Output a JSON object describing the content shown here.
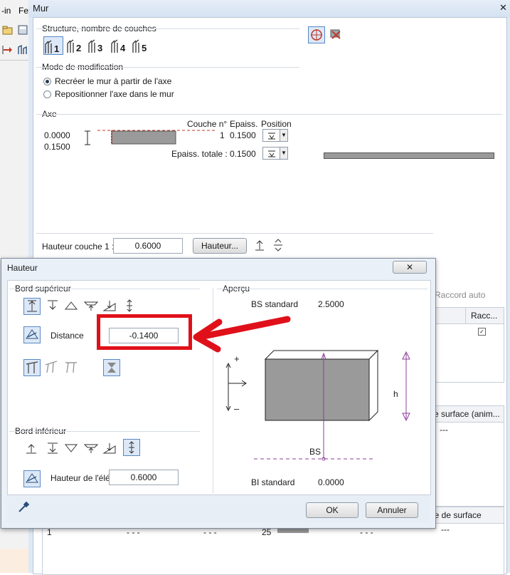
{
  "app": {
    "menu_items": [
      "-in",
      "Fe"
    ]
  },
  "mur_window": {
    "title": "Mur",
    "close_glyph": "✕",
    "structure_group": {
      "label": "Structure, nombre de couches",
      "layer_buttons": [
        "1",
        "2",
        "3",
        "4",
        "5"
      ]
    },
    "mode_group": {
      "label": "Mode de modification",
      "options": [
        {
          "label": "Recréer le mur à partir de l'axe",
          "selected": true
        },
        {
          "label": "Repositionner l'axe dans le mur",
          "selected": false
        }
      ]
    },
    "axe_group": {
      "label": "Axe",
      "axis_values": [
        "0.0000",
        "0.1500"
      ],
      "col_couche": "Couche n°",
      "col_epaiss": "Epaiss.",
      "col_position": "Position",
      "layer_number": "1",
      "layer_thickness": "0.1500",
      "total_label": "Epaiss. totale :",
      "total_value": "0.1500"
    },
    "hauteur_couche": {
      "label": "Hauteur couche 1 :",
      "value": "0.6000",
      "button_label": "Hauteur..."
    },
    "background_panels": {
      "raccord_auto": "Raccord auto",
      "racc_col": "Racc...",
      "surface_anim": "e surface (anim...",
      "dashes": "---",
      "de_surface": "de de surface",
      "bottom_row": [
        "1",
        "- - -",
        "- - -",
        "25",
        "- - -",
        "- - -"
      ]
    }
  },
  "hauteur_dialog": {
    "title": "Hauteur",
    "close_glyph": "✕",
    "bord_superieur": {
      "label": "Bord supérieur",
      "distance_label": "Distance",
      "distance_value": "-0.1400"
    },
    "bord_inferieur": {
      "label": "Bord inférieur",
      "hauteur_label": "Hauteur de l'élé",
      "hauteur_value": "0.6000"
    },
    "apercu": {
      "label": "Aperçu",
      "bs_standard_label": "BS standard",
      "bs_standard_value": "2.5000",
      "bi_standard_label": "BI standard",
      "bi_standard_value": "0.0000",
      "bs_marker": "BS",
      "h_marker": "h",
      "plus_marker": "+",
      "minus_marker": "–"
    },
    "ok_label": "OK",
    "cancel_label": "Annuler"
  },
  "annotation": {
    "highlight_color": "#e0101a"
  }
}
